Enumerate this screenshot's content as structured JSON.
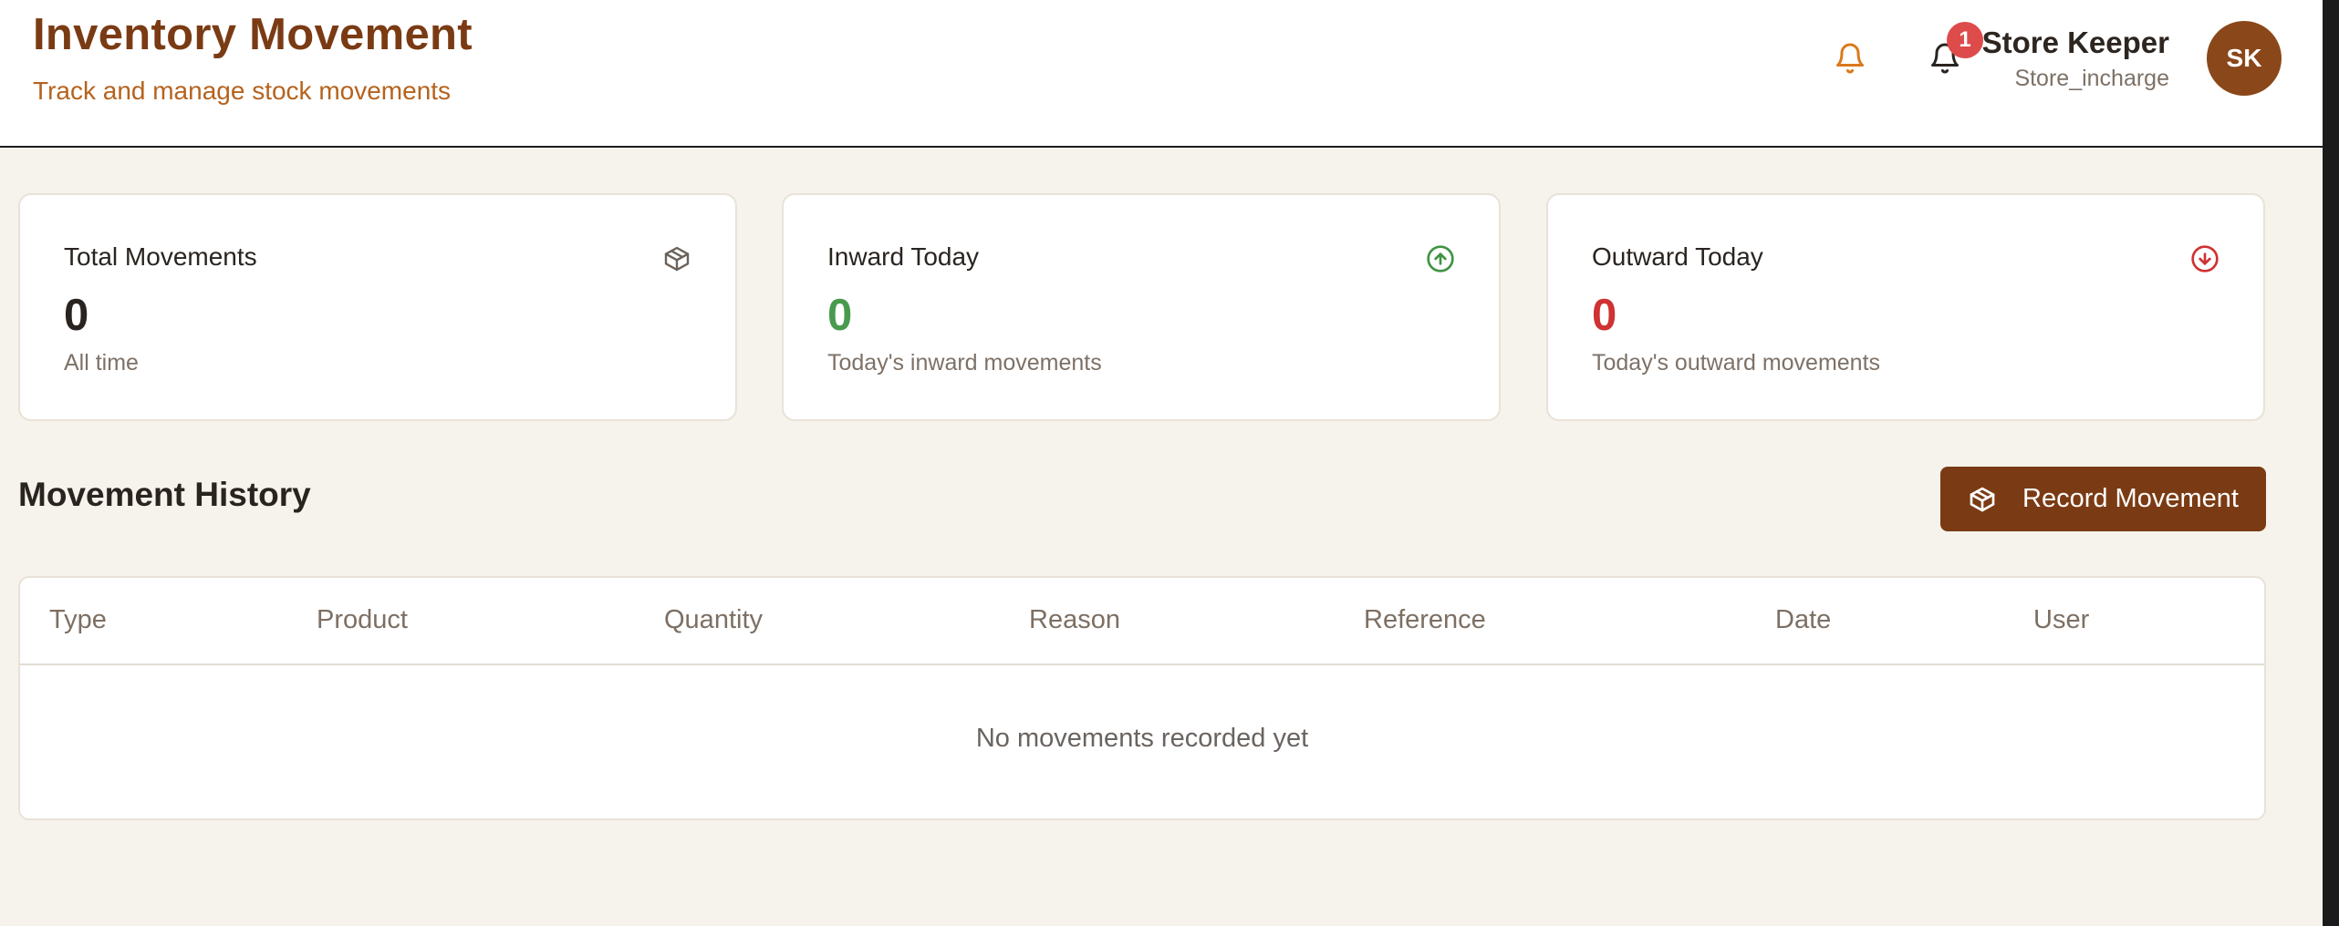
{
  "header": {
    "title": "Inventory Movement",
    "subtitle": "Track and manage stock movements",
    "notification_count": "1",
    "user": {
      "name": "Store Keeper",
      "role": "Store_incharge",
      "initials": "SK"
    }
  },
  "stats": [
    {
      "title": "Total Movements",
      "value": "0",
      "caption": "All time",
      "icon": "package-icon"
    },
    {
      "title": "Inward Today",
      "value": "0",
      "caption": "Today's inward movements",
      "icon": "arrow-up-circle-icon"
    },
    {
      "title": "Outward Today",
      "value": "0",
      "caption": "Today's outward movements",
      "icon": "arrow-down-circle-icon"
    }
  ],
  "history": {
    "title": "Movement History",
    "record_button": "Record Movement",
    "columns": [
      "Type",
      "Product",
      "Quantity",
      "Reason",
      "Reference",
      "Date",
      "User"
    ],
    "empty_message": "No movements recorded yet"
  },
  "colors": {
    "brand": "#7a3b14",
    "accent": "#b5631e",
    "inward": "#4a9a4e",
    "outward": "#cf3232",
    "badge": "#de4b4b"
  }
}
